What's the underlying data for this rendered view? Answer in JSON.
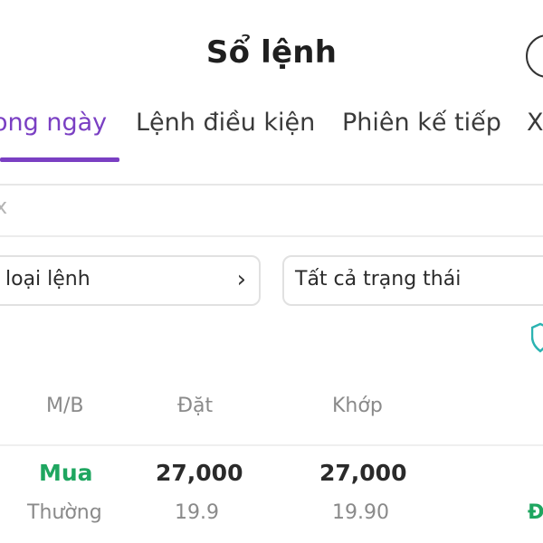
{
  "header": {
    "title": "Sổ lệnh"
  },
  "tabs": [
    {
      "label": "ong ngày",
      "active": true
    },
    {
      "label": "Lệnh điều kiện",
      "active": false
    },
    {
      "label": "Phiên kế tiếp",
      "active": false
    },
    {
      "label": "X",
      "active": false
    }
  ],
  "search": {
    "clear_glyph": "x"
  },
  "filters": {
    "order_type": "loại lệnh",
    "order_type_chevron": "›",
    "status": "Tất cả trạng thái"
  },
  "table": {
    "columns": [
      "M/B",
      "Đặt",
      "Khớp"
    ],
    "rows": [
      {
        "side": "Mua",
        "side_type": "Thường",
        "order_qty": "27,000",
        "order_price": "19.9",
        "matched_qty": "27,000",
        "matched_price": "19.90",
        "status_partial": "Đ"
      }
    ]
  },
  "colors": {
    "accent": "#7a3fc3",
    "buy": "#1fa660",
    "shield": "#2bb3b1"
  },
  "icons": {
    "profile": "circle-icon",
    "chevron": "chevron-right-icon",
    "filter": "shield-icon"
  }
}
